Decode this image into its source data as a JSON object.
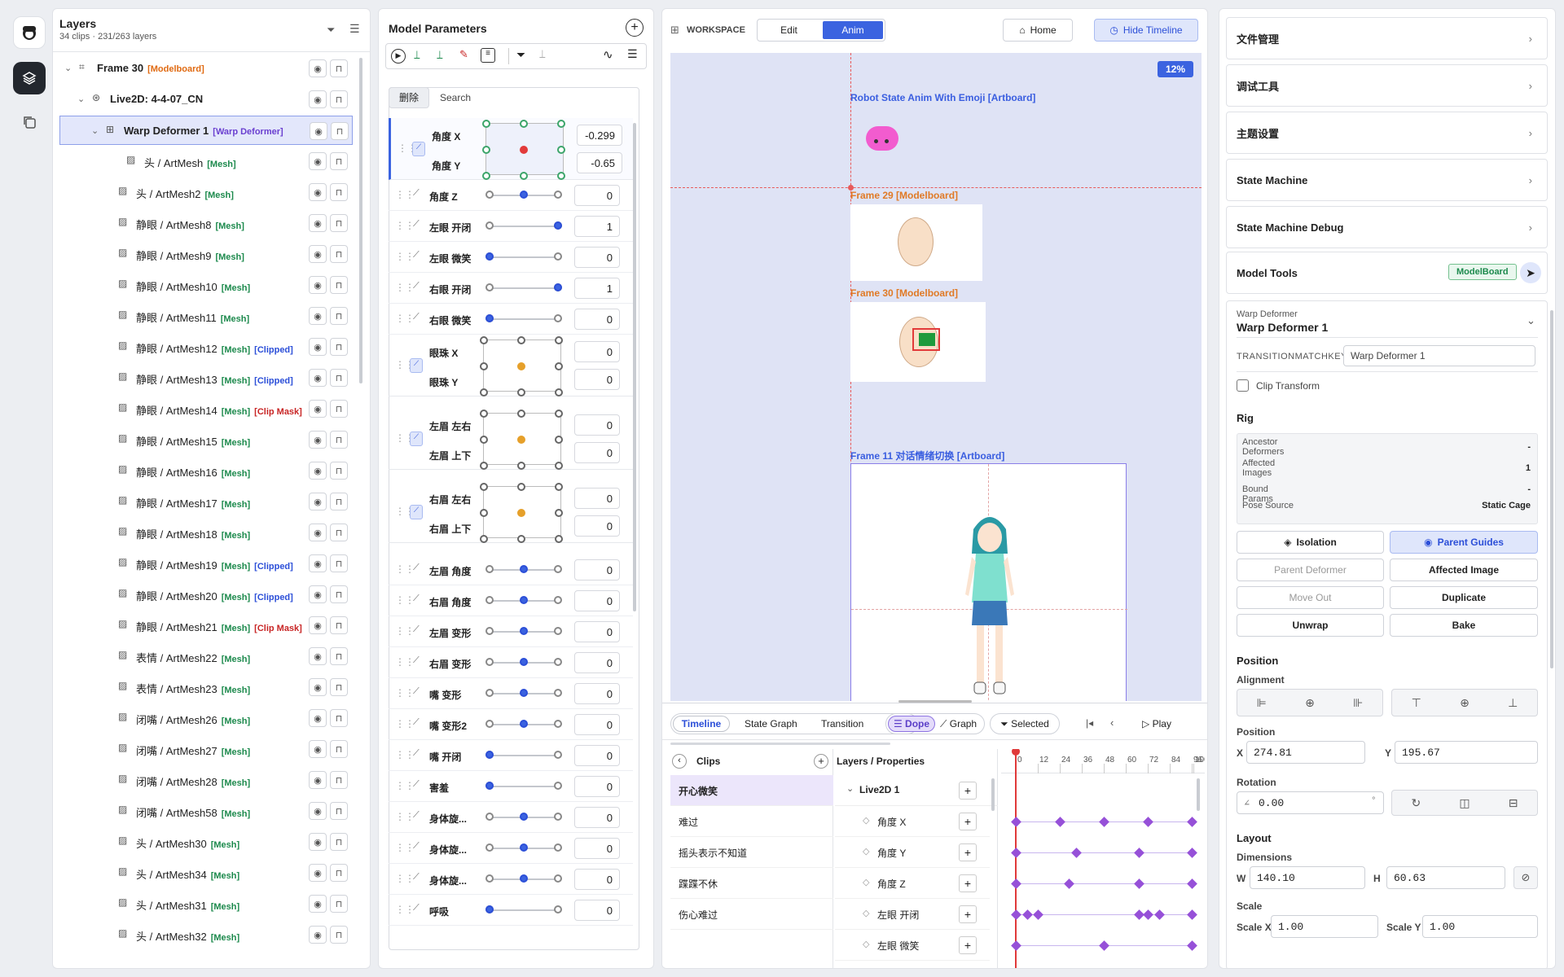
{
  "layers_panel": {
    "title": "Layers",
    "subtitle": "34 clips · 231/263 layers",
    "rows": [
      {
        "name": "Frame 30",
        "tag": "[Modelboard]"
      },
      {
        "name": "Live2D: 4-4-07_CN",
        "tag": ""
      },
      {
        "name": "Warp Deformer 1",
        "tag": "[Warp Deformer]"
      },
      {
        "name": "头 / ArtMesh",
        "tag": "[Mesh]"
      },
      {
        "name": "头 / ArtMesh2",
        "tag": "[Mesh]"
      },
      {
        "name": "静眼 / ArtMesh8",
        "tag": "[Mesh]"
      },
      {
        "name": "静眼 / ArtMesh9",
        "tag": "[Mesh]"
      },
      {
        "name": "静眼 / ArtMesh10",
        "tag": "[Mesh]"
      },
      {
        "name": "静眼 / ArtMesh11",
        "tag": "[Mesh]"
      },
      {
        "name": "静眼 / ArtMesh12",
        "tag": "[Mesh]",
        "tag2": "[Clipped]"
      },
      {
        "name": "静眼 / ArtMesh13",
        "tag": "[Mesh]",
        "tag2": "[Clipped]"
      },
      {
        "name": "静眼 / ArtMesh14",
        "tag": "[Mesh]",
        "tag3": "[Clip Mask]"
      },
      {
        "name": "静眼 / ArtMesh15",
        "tag": "[Mesh]"
      },
      {
        "name": "静眼 / ArtMesh16",
        "tag": "[Mesh]"
      },
      {
        "name": "静眼 / ArtMesh17",
        "tag": "[Mesh]"
      },
      {
        "name": "静眼 / ArtMesh18",
        "tag": "[Mesh]"
      },
      {
        "name": "静眼 / ArtMesh19",
        "tag": "[Mesh]",
        "tag2": "[Clipped]"
      },
      {
        "name": "静眼 / ArtMesh20",
        "tag": "[Mesh]",
        "tag2": "[Clipped]"
      },
      {
        "name": "静眼 / ArtMesh21",
        "tag": "[Mesh]",
        "tag3": "[Clip Mask]"
      },
      {
        "name": "表情 / ArtMesh22",
        "tag": "[Mesh]"
      },
      {
        "name": "表情 / ArtMesh23",
        "tag": "[Mesh]"
      },
      {
        "name": "闭嘴 / ArtMesh26",
        "tag": "[Mesh]"
      },
      {
        "name": "闭嘴 / ArtMesh27",
        "tag": "[Mesh]"
      },
      {
        "name": "闭嘴 / ArtMesh28",
        "tag": "[Mesh]"
      },
      {
        "name": "闭嘴 / ArtMesh58",
        "tag": "[Mesh]"
      },
      {
        "name": "头 / ArtMesh30",
        "tag": "[Mesh]"
      },
      {
        "name": "头 / ArtMesh34",
        "tag": "[Mesh]"
      },
      {
        "name": "头 / ArtMesh31",
        "tag": "[Mesh]"
      },
      {
        "name": "头 / ArtMesh32",
        "tag": "[Mesh]"
      }
    ]
  },
  "params": {
    "title": "Model Parameters",
    "tab_delete": "删除",
    "tab_search": "Search",
    "pad_rows": [
      {
        "a": "角度 X",
        "av": "-0.299",
        "b": "角度 Y",
        "bv": "-0.65"
      },
      {
        "a": "眼珠 X",
        "av": "0",
        "b": "眼珠 Y",
        "bv": "0"
      },
      {
        "a": "左眉 左右",
        "av": "0",
        "b": "左眉 上下",
        "bv": "0"
      },
      {
        "a": "右眉 左右",
        "av": "0",
        "b": "右眉 上下",
        "bv": "0"
      }
    ],
    "sliders": [
      {
        "label": "角度 Z",
        "value": "0",
        "pos": 0.5
      },
      {
        "label": "左眼 开闭",
        "value": "1",
        "pos": 1
      },
      {
        "label": "左眼 微笑",
        "value": "0",
        "pos": 0
      },
      {
        "label": "右眼 开闭",
        "value": "1",
        "pos": 1
      },
      {
        "label": "右眼 微笑",
        "value": "0",
        "pos": 0
      },
      {
        "label": "左眉 角度",
        "value": "0",
        "pos": 0.5
      },
      {
        "label": "右眉 角度",
        "value": "0",
        "pos": 0.5
      },
      {
        "label": "左眉 变形",
        "value": "0",
        "pos": 0.5
      },
      {
        "label": "右眉 变形",
        "value": "0",
        "pos": 0.5
      },
      {
        "label": "嘴 变形",
        "value": "0",
        "pos": 0.5
      },
      {
        "label": "嘴 变形2",
        "value": "0",
        "pos": 0.5
      },
      {
        "label": "嘴 开闭",
        "value": "0",
        "pos": 0
      },
      {
        "label": "害羞",
        "value": "0",
        "pos": 0
      },
      {
        "label": "身体旋...",
        "value": "0",
        "pos": 0.5
      },
      {
        "label": "身体旋...",
        "value": "0",
        "pos": 0.5
      },
      {
        "label": "身体旋...",
        "value": "0",
        "pos": 0.5
      },
      {
        "label": "呼吸",
        "value": "0",
        "pos": 0
      }
    ]
  },
  "workspace": {
    "label": "WORKSPACE",
    "mode_edit": "Edit",
    "mode_anim": "Anim",
    "home": "Home",
    "hide_timeline": "Hide Timeline",
    "zoom": "12%",
    "artboards": {
      "a1": "Robot State Anim With Emoji [Artboard]",
      "f29": "Frame 29 [Modelboard]",
      "f30": "Frame 30 [Modelboard]",
      "f11": "Frame 11 对话情绪切换 [Artboard]"
    }
  },
  "timeline": {
    "tabs": [
      "Timeline",
      "State Graph",
      "Transition"
    ],
    "dope": "Dope",
    "graph": "Graph",
    "selected": "Selected",
    "play": "Play",
    "clips_header": "Clips",
    "layers_header": "Layers / Properties",
    "clips": [
      "开心微笑",
      "难过",
      "摇头表示不知道",
      "蹀蹀不休",
      "伤心难过"
    ],
    "group": "Live2D 1",
    "props": [
      "角度 X",
      "角度 Y",
      "角度 Z",
      "左眼 开闭",
      "左眼 微笑"
    ],
    "ticks": [
      "0",
      "12",
      "24",
      "36",
      "48",
      "60",
      "72",
      "84",
      "96",
      "100"
    ]
  },
  "inspector": {
    "sections": [
      "文件管理",
      "调试工具",
      "主题设置",
      "State Machine",
      "State Machine Debug"
    ],
    "model_tools": "Model Tools",
    "modelboard_badge": "ModelBoard",
    "sel_type": "Warp Deformer",
    "sel_name": "Warp Deformer 1",
    "tkey_label": "TRANSITIONMATCHKEY",
    "tkey_value": "Warp Deformer 1",
    "clip_transform": "Clip Transform",
    "rig": "Rig",
    "rig_rows": [
      {
        "k": "Ancestor Deformers",
        "v": "-"
      },
      {
        "k": "Affected Images",
        "v": "1"
      },
      {
        "k": "Bound Params",
        "v": "-"
      },
      {
        "k": "Pose Source",
        "v": "Static Cage"
      }
    ],
    "btn_isolation": "Isolation",
    "btn_parent_guides": "Parent Guides",
    "btn_parent_deformer": "Parent Deformer",
    "btn_affected_image": "Affected Image",
    "btn_move_out": "Move Out",
    "btn_duplicate": "Duplicate",
    "btn_unwrap": "Unwrap",
    "btn_bake": "Bake",
    "position": "Position",
    "alignment": "Alignment",
    "position_sub": "Position",
    "x_label": "X",
    "x": "274.81",
    "y_label": "Y",
    "y": "195.67",
    "rotation": "Rotation",
    "rot": "0.00",
    "rot_unit": "°",
    "layout": "Layout",
    "dimensions": "Dimensions",
    "w_label": "W",
    "w": "140.10",
    "h_label": "H",
    "h": "60.63",
    "scale": "Scale",
    "sx_label": "Scale X",
    "sx": "1.00",
    "sy_label": "Scale Y",
    "sy": "1.00"
  }
}
